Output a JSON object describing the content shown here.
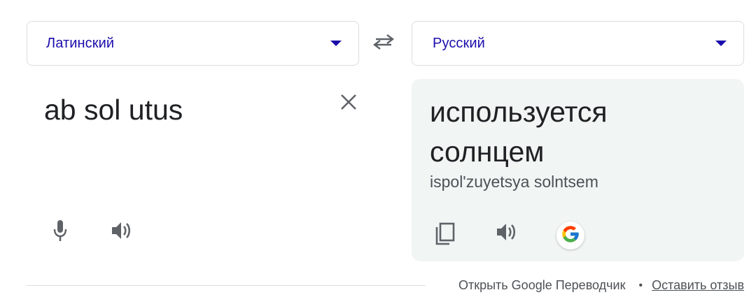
{
  "source_language": {
    "label": "Латинский",
    "icon": "chevron-down-icon"
  },
  "target_language": {
    "label": "Русский",
    "icon": "chevron-down-icon"
  },
  "swap": {
    "icon": "swap-arrows-icon"
  },
  "source": {
    "text": "ab sol utus",
    "clear_icon": "close-icon",
    "mic_icon": "microphone-icon",
    "speaker_icon": "speaker-icon"
  },
  "target": {
    "text": "используется солнцем",
    "transliteration": "ispol'zuyetsya solntsem",
    "copy_icon": "copy-icon",
    "speaker_icon": "speaker-icon",
    "google_icon": "google-logo-icon"
  },
  "footer": {
    "open_link": "Открыть Google Переводчик",
    "separator": "•",
    "feedback_link": "Оставить отзыв"
  },
  "colors": {
    "language_label": "#1a0dab",
    "dropdown_arrow": "#1a0dab",
    "icon_gray": "#5f6368",
    "target_background": "#f1f5f4",
    "border": "#dadce0"
  }
}
